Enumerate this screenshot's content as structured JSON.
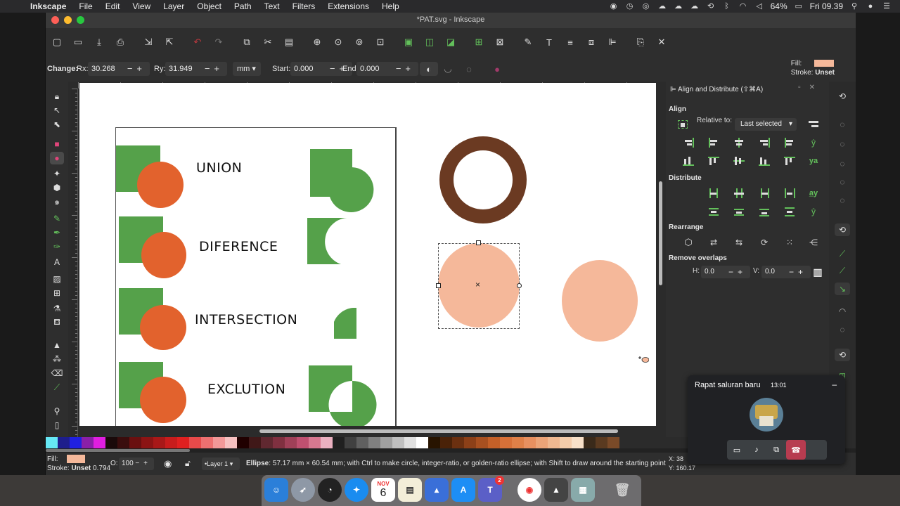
{
  "menubar": {
    "app": "Inkscape",
    "items": [
      "File",
      "Edit",
      "View",
      "Layer",
      "Object",
      "Path",
      "Text",
      "Filters",
      "Extensions",
      "Help"
    ],
    "battery": "64%",
    "clock": "Fri 09.39"
  },
  "window": {
    "title": "*PAT.svg - Inkscape"
  },
  "controls": {
    "change_label": "Change:",
    "rx_label": "Rx:",
    "rx_value": "30.268",
    "ry_label": "Ry:",
    "ry_value": "31.949",
    "unit": "mm",
    "start_label": "Start:",
    "start_value": "0.000",
    "end_label": "End:",
    "end_value": "0.000",
    "fill_label": "Fill:",
    "stroke_label": "Stroke:",
    "stroke_value": "Unset"
  },
  "canvas": {
    "labels": {
      "union": "UNION",
      "difference": "DIFERENCE",
      "intersection": "INTERSECTION",
      "exclusion": "EXCLUTION"
    },
    "colors": {
      "green": "#55a14a",
      "orange": "#e2622d",
      "brown": "#6b3a22",
      "peach": "#f5b89a"
    }
  },
  "align_panel": {
    "title": "Align and Distribute (⇧⌘A)",
    "align_section": "Align",
    "relative_to_label": "Relative to:",
    "relative_to_value": "Last selected",
    "distribute_section": "Distribute",
    "rearrange_section": "Rearrange",
    "remove_overlaps_section": "Remove overlaps",
    "h_label": "H:",
    "h_value": "0.0",
    "v_label": "V:",
    "v_value": "0.0"
  },
  "palette": [
    "#66e8f5",
    "#1e1e8c",
    "#2020e0",
    "#8a1fa8",
    "#e01ee0",
    "#1a0a0a",
    "#3a0d0d",
    "#6a1010",
    "#8c1414",
    "#a81818",
    "#c81c1c",
    "#e02020",
    "#e84a4a",
    "#ee7070",
    "#f39898",
    "#f7c0c0",
    "#200000",
    "#401818",
    "#602830",
    "#803040",
    "#a04058",
    "#c05070",
    "#d87890",
    "#eab0c0",
    "#202020",
    "#404040",
    "#606060",
    "#808080",
    "#a0a0a0",
    "#c0c0c0",
    "#e0e0e0",
    "#ffffff",
    "#281400",
    "#4a2208",
    "#6b3010",
    "#8c4018",
    "#a85020",
    "#c46028",
    "#d87038",
    "#e08048",
    "#e89060",
    "#eca478",
    "#f0b890",
    "#f4ccaa",
    "#f8e0c8",
    "#3a2a1a",
    "#5a3a20",
    "#7a4a28"
  ],
  "status": {
    "fill_label": "Fill:",
    "stroke_label": "Stroke:",
    "stroke_value": "Unset",
    "stroke_width": "0.794",
    "opacity_label": "O:",
    "opacity_value": "100",
    "layer": "•Layer 1",
    "message_bold": "Ellipse",
    "message": ": 57.17 mm × 60.54 mm; with Ctrl to make circle, integer-ratio, or golden-ratio ellipse; with Shift to draw around the starting point",
    "x_label": "X:",
    "x_value": "38",
    "y_label": "Y:",
    "y_value": "160.17"
  },
  "meet": {
    "title": "Rapat saluran baru",
    "time": "13:01"
  },
  "dock": {
    "calendar_month": "NOV",
    "calendar_day": "6",
    "teams_badge": "2"
  }
}
